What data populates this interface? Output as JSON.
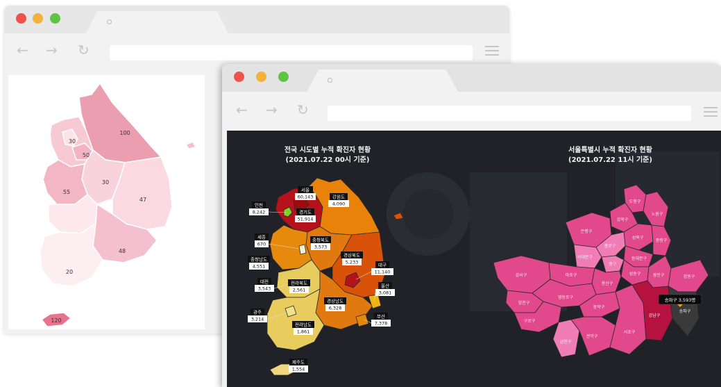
{
  "back_window": {
    "map_values": [
      "100",
      "30",
      "50",
      "30",
      "55",
      "47",
      "48",
      "20",
      "120"
    ]
  },
  "front_window": {
    "national": {
      "title_line1": "전국 시도별 누적 확진자 현황",
      "title_line2": "(2021.07.22 00시 기준)",
      "regions": [
        {
          "name": "서울",
          "value": "60,143"
        },
        {
          "name": "강원도",
          "value": "4,090"
        },
        {
          "name": "인천",
          "value": "8,242"
        },
        {
          "name": "경기도",
          "value": "51,914"
        },
        {
          "name": "세종",
          "value": "670"
        },
        {
          "name": "충청북도",
          "value": "3,573"
        },
        {
          "name": "충청남도",
          "value": "4,551"
        },
        {
          "name": "경상북도",
          "value": "5,233"
        },
        {
          "name": "대전",
          "value": "3,543"
        },
        {
          "name": "대구",
          "value": "11,140"
        },
        {
          "name": "전라북도",
          "value": "2,561"
        },
        {
          "name": "울산",
          "value": "3,081"
        },
        {
          "name": "경상남도",
          "value": "6,328"
        },
        {
          "name": "광주",
          "value": "3,214"
        },
        {
          "name": "부산",
          "value": "7,378"
        },
        {
          "name": "전라남도",
          "value": "1,861"
        },
        {
          "name": "제주도",
          "value": "1,554"
        }
      ]
    },
    "seoul": {
      "title_line1": "서울특별시 누적 확진자 현황",
      "title_line2": "(2021.07.22 11시 기준)",
      "tooltip": "송파구 3,593명",
      "districts": [
        "도봉구",
        "강북구",
        "노원구",
        "은평구",
        "성북구",
        "중랑구",
        "종로구",
        "동대문구",
        "서대문구",
        "마포구",
        "중구",
        "성동구",
        "광진구",
        "강동구",
        "강서구",
        "용산구",
        "양천구",
        "영등포구",
        "동작구",
        "구로구",
        "금천구",
        "관악구",
        "서초구",
        "강남구",
        "송파구"
      ]
    },
    "colors": {
      "seoul": "#9c0b0f",
      "gyeonggi": "#b5121b",
      "incheon_marker": "#7ed321",
      "orange_dark": "#d9520a",
      "orange": "#e8820a",
      "yellow": "#e8cd5e",
      "pale": "#f0e08a",
      "pink": "#e2488c",
      "pink_light": "#f07db6",
      "crimson": "#b5123f"
    }
  }
}
